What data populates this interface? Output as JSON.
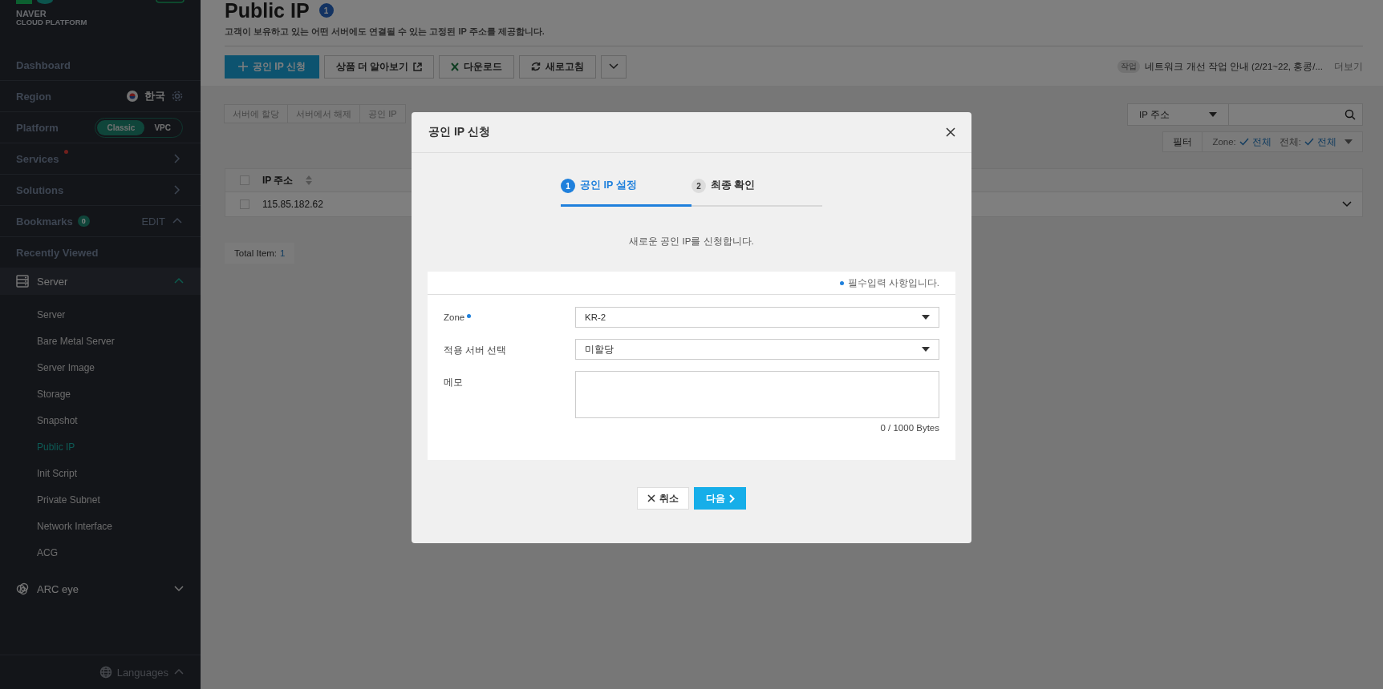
{
  "sidebar": {
    "brand": "NAVER",
    "brand_sub": "CLOUD PLATFORM",
    "menu": [
      {
        "kind": "link",
        "label": "Dashboard"
      },
      {
        "kind": "region",
        "label": "Region",
        "value": "한국"
      },
      {
        "kind": "toggle",
        "label": "Platform",
        "options": [
          {
            "label": "Classic",
            "selected": true
          },
          {
            "label": "VPC",
            "selected": false
          }
        ]
      },
      {
        "kind": "nav",
        "label": "Services",
        "alert": true
      },
      {
        "kind": "nav",
        "label": "Solutions",
        "alert": false
      },
      {
        "kind": "bookmarks",
        "label": "Bookmarks",
        "count": "0",
        "action": "EDIT",
        "expanded": true
      },
      {
        "kind": "link",
        "label": "Recently Viewed"
      }
    ],
    "groups": [
      {
        "label": "Server",
        "expanded": true,
        "children": [
          {
            "label": "Server",
            "selected": false
          },
          {
            "label": "Bare Metal Server",
            "selected": false
          },
          {
            "label": "Server Image",
            "selected": false
          },
          {
            "label": "Storage",
            "selected": false
          },
          {
            "label": "Snapshot",
            "selected": false
          },
          {
            "label": "Public IP",
            "selected": true
          },
          {
            "label": "Init Script",
            "selected": false
          },
          {
            "label": "Private Subnet",
            "selected": false
          },
          {
            "label": "Network Interface",
            "selected": false
          },
          {
            "label": "ACG",
            "selected": false
          }
        ]
      },
      {
        "label": "ARC eye",
        "expanded": false
      }
    ],
    "footer": {
      "label": "Languages"
    }
  },
  "page": {
    "title": "Public IP",
    "count": "1",
    "description": "고객이 보유하고 있는 어떤 서버에도 연결될 수 있는 고정된 IP 주소를 제공합니다.",
    "toolbar": [
      {
        "kind": "primary",
        "label": "공인 IP 신청"
      },
      {
        "kind": "external",
        "label": "상품 더 알아보기"
      },
      {
        "kind": "excel",
        "label": "다운로드"
      },
      {
        "kind": "refresh",
        "label": "새로고침"
      },
      {
        "kind": "more"
      }
    ],
    "notice": {
      "tag": "작업",
      "text": "네트워크 개선 작업 안내 (2/21~22, 홍콩/...",
      "more": "더보기"
    },
    "actions": [
      {
        "label": "서버에 할당",
        "disabled": true
      },
      {
        "label": "서버에서 해제",
        "disabled": true
      },
      {
        "label": "공인 IP",
        "disabled": true
      }
    ],
    "search": {
      "field": "IP 주소"
    },
    "filter": {
      "label": "필터",
      "zone_label": "Zone:",
      "zone_value": "전체",
      "all_label": "전체:",
      "all_value": "전체"
    },
    "table": {
      "all_checked": false,
      "columns": [
        {
          "label": "IP 주소",
          "sortable": true
        }
      ],
      "rows": [
        {
          "ip": "115.85.182.62",
          "checked": false,
          "expanded": false
        }
      ]
    },
    "total": {
      "label": "Total Item:",
      "count": "1"
    }
  },
  "modal": {
    "title": "공인 IP 신청",
    "steps": [
      {
        "number": "1",
        "label": "공인 IP 설정",
        "selected": true
      },
      {
        "number": "2",
        "label": "최종 확인",
        "selected": false
      }
    ],
    "intro": "새로운 공인 IP를 신청합니다.",
    "required_note": "필수입력 사항입니다.",
    "fields": [
      {
        "kind": "select",
        "label": "Zone",
        "required": true,
        "value": "KR-2"
      },
      {
        "kind": "select",
        "label": "적용 서버 선택",
        "required": false,
        "value": "미할당"
      },
      {
        "kind": "textarea",
        "label": "메모",
        "required": false,
        "counter": "0 / 1000 Bytes"
      }
    ],
    "buttons": [
      {
        "kind": "cancel",
        "label": "취소"
      },
      {
        "kind": "next",
        "label": "다음"
      }
    ]
  }
}
